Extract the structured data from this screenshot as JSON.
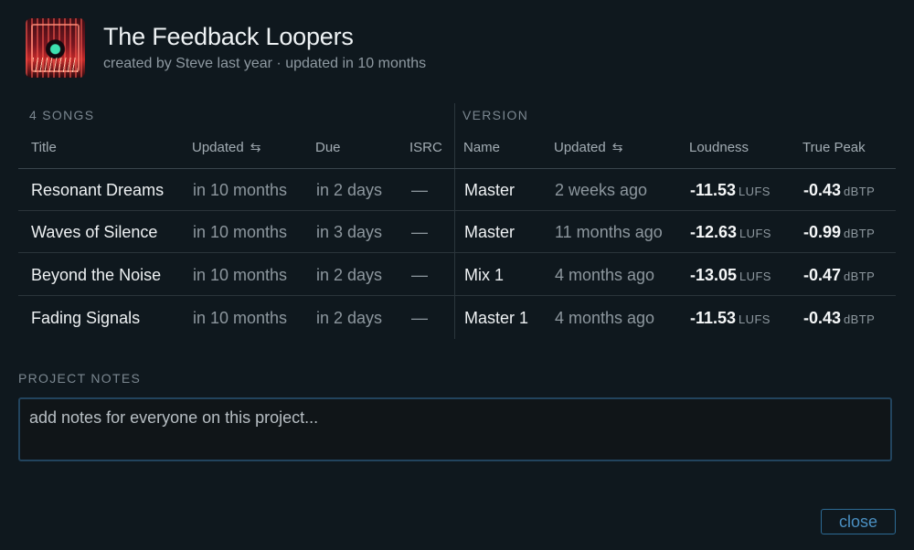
{
  "project": {
    "title": "The Feedback Loopers",
    "subtitle": "created by Steve last year · updated in 10 months",
    "artwork_icon": "album-artwork"
  },
  "songs_section": {
    "count_label": "4 SONGS",
    "columns": {
      "title": "Title",
      "updated": "Updated",
      "due": "Due",
      "isrc": "ISRC"
    }
  },
  "version_section": {
    "label": "VERSION",
    "columns": {
      "name": "Name",
      "updated": "Updated",
      "loudness": "Loudness",
      "true_peak": "True Peak"
    }
  },
  "sort_icon": "⇆",
  "units": {
    "loudness": "LUFS",
    "true_peak": "dBTP"
  },
  "rows": [
    {
      "title": "Resonant Dreams",
      "updated": "in 10 months",
      "due": "in 2 days",
      "isrc": "—",
      "version_name": "Master",
      "version_updated": "2 weeks ago",
      "loudness": "-11.53",
      "true_peak": "-0.43"
    },
    {
      "title": "Waves of Silence",
      "updated": "in 10 months",
      "due": "in 3 days",
      "isrc": "—",
      "version_name": "Master",
      "version_updated": "11 months ago",
      "loudness": "-12.63",
      "true_peak": "-0.99"
    },
    {
      "title": "Beyond the Noise",
      "updated": "in 10 months",
      "due": "in 2 days",
      "isrc": "—",
      "version_name": "Mix 1",
      "version_updated": "4 months ago",
      "loudness": "-13.05",
      "true_peak": "-0.47"
    },
    {
      "title": "Fading Signals",
      "updated": "in 10 months",
      "due": "in 2 days",
      "isrc": "—",
      "version_name": "Master 1",
      "version_updated": "4 months ago",
      "loudness": "-11.53",
      "true_peak": "-0.43"
    }
  ],
  "notes": {
    "label": "PROJECT NOTES",
    "placeholder": "add notes for everyone on this project...",
    "value": ""
  },
  "actions": {
    "close_label": "close"
  },
  "colors": {
    "background": "#0f181e",
    "accent": "#4a8fc1",
    "muted_text": "#8d979e"
  }
}
